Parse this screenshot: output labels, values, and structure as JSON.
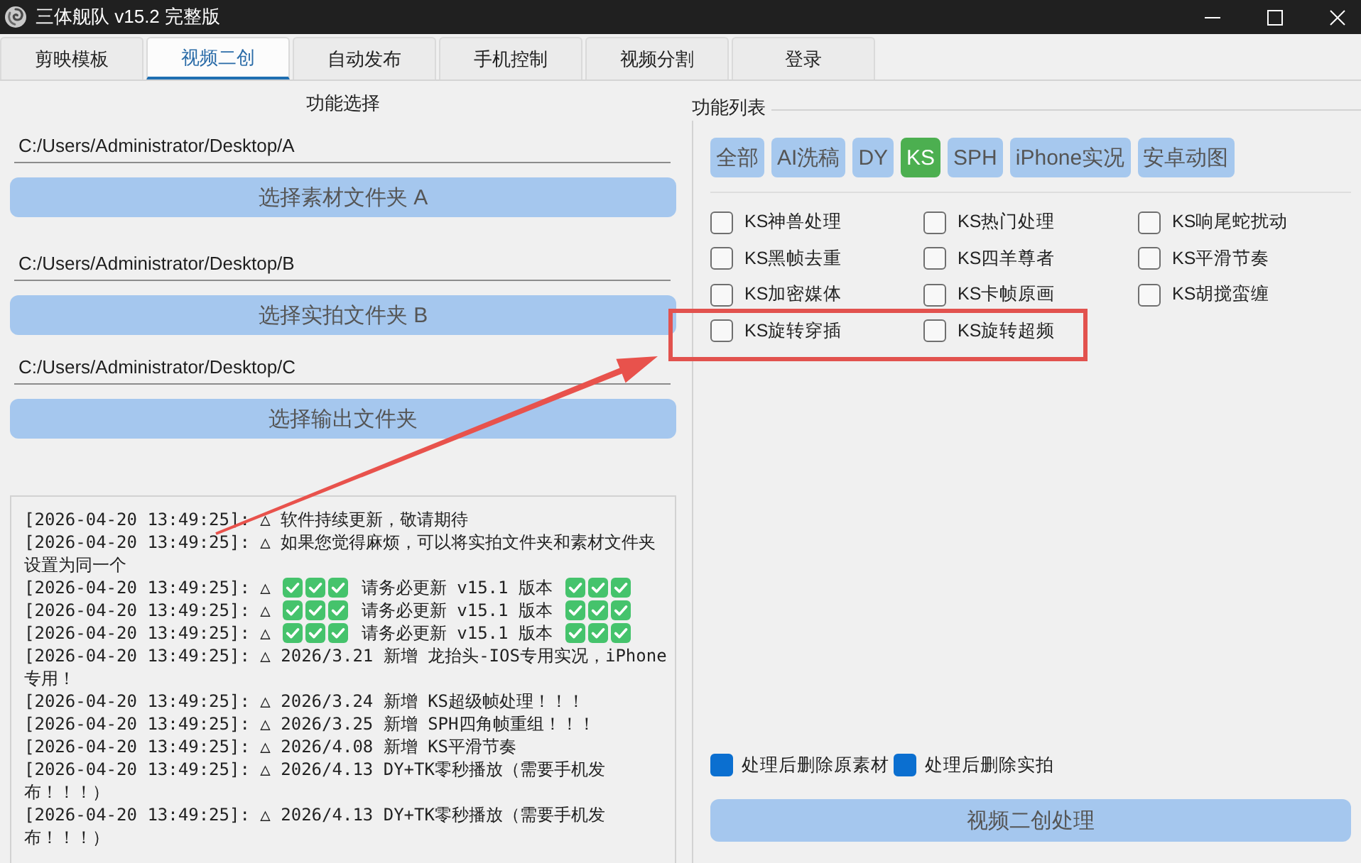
{
  "window": {
    "title": "三体舰队 v15.2 完整版"
  },
  "tabs": [
    {
      "label": "剪映模板",
      "selected": false
    },
    {
      "label": "视频二创",
      "selected": true
    },
    {
      "label": "自动发布",
      "selected": false
    },
    {
      "label": "手机控制",
      "selected": false
    },
    {
      "label": "视频分割",
      "selected": false
    },
    {
      "label": "登录",
      "selected": false
    }
  ],
  "folder_panel": {
    "title": "功能选择",
    "folders": [
      {
        "path": "C:/Users/Administrator/Desktop/A",
        "button": "选择素材文件夹 A"
      },
      {
        "path": "C:/Users/Administrator/Desktop/B",
        "button": "选择实拍文件夹 B"
      },
      {
        "path": "C:/Users/Administrator/Desktop/C",
        "button": "选择输出文件夹"
      }
    ]
  },
  "log": [
    {
      "parts": [
        {
          "kind": "text",
          "text": "[2026-04-20 13:49:25]: △ 软件持续更新，敬请期待"
        }
      ]
    },
    {
      "parts": [
        {
          "kind": "text",
          "text": "[2026-04-20 13:49:25]: △ 如果您觉得麻烦，可以将实拍文件夹和素材文件夹设置为同一个"
        }
      ]
    },
    {
      "parts": [
        {
          "kind": "text",
          "text": "[2026-04-20 13:49:25]: △"
        },
        {
          "kind": "check"
        },
        {
          "kind": "check"
        },
        {
          "kind": "check"
        },
        {
          "kind": "text",
          "text": "请务必更新 v15.1 版本"
        },
        {
          "kind": "check"
        },
        {
          "kind": "check"
        },
        {
          "kind": "check"
        }
      ]
    },
    {
      "parts": [
        {
          "kind": "text",
          "text": "[2026-04-20 13:49:25]: △"
        },
        {
          "kind": "check"
        },
        {
          "kind": "check"
        },
        {
          "kind": "check"
        },
        {
          "kind": "text",
          "text": "请务必更新 v15.1 版本"
        },
        {
          "kind": "check"
        },
        {
          "kind": "check"
        },
        {
          "kind": "check"
        }
      ]
    },
    {
      "parts": [
        {
          "kind": "text",
          "text": "[2026-04-20 13:49:25]: △"
        },
        {
          "kind": "check"
        },
        {
          "kind": "check"
        },
        {
          "kind": "check"
        },
        {
          "kind": "text",
          "text": "请务必更新 v15.1 版本"
        },
        {
          "kind": "check"
        },
        {
          "kind": "check"
        },
        {
          "kind": "check"
        }
      ]
    },
    {
      "parts": [
        {
          "kind": "text",
          "text": "[2026-04-20 13:49:25]: △ 2026/3.21 新增 龙抬头-IOS专用实况，iPhone专用！"
        }
      ]
    },
    {
      "parts": [
        {
          "kind": "text",
          "text": "[2026-04-20 13:49:25]: △ 2026/3.24 新增 KS超级帧处理！！！"
        }
      ]
    },
    {
      "parts": [
        {
          "kind": "text",
          "text": "[2026-04-20 13:49:25]: △ 2026/3.25 新增 SPH四角帧重组！！！"
        }
      ]
    },
    {
      "parts": [
        {
          "kind": "text",
          "text": "[2026-04-20 13:49:25]: △ 2026/4.08 新增 KS平滑节奏"
        }
      ]
    },
    {
      "parts": [
        {
          "kind": "text",
          "text": "[2026-04-20 13:49:25]: △ 2026/4.13 DY+TK零秒播放（需要手机发布！！！）"
        }
      ]
    },
    {
      "parts": [
        {
          "kind": "text",
          "text": "[2026-04-20 13:49:25]: △ 2026/4.13 DY+TK零秒播放（需要手机发布！！！）"
        }
      ]
    }
  ],
  "feature_list": {
    "title": "功能列表",
    "filters": [
      {
        "label": "全部",
        "selected": false
      },
      {
        "label": "AI洗稿",
        "selected": false
      },
      {
        "label": "DY",
        "selected": false
      },
      {
        "label": "KS",
        "selected": true
      },
      {
        "label": "SPH",
        "selected": false
      },
      {
        "label": "iPhone实况",
        "selected": false
      },
      {
        "label": "安卓动图",
        "selected": false
      }
    ],
    "features": [
      {
        "label": "KS神兽处理",
        "checked": false
      },
      {
        "label": "KS热门处理",
        "checked": false
      },
      {
        "label": "KS响尾蛇扰动",
        "checked": false
      },
      {
        "label": "KS黑帧去重",
        "checked": false
      },
      {
        "label": "KS四羊尊者",
        "checked": false
      },
      {
        "label": "KS平滑节奏",
        "checked": false
      },
      {
        "label": "KS加密媒体",
        "checked": false
      },
      {
        "label": "KS卡帧原画",
        "checked": false
      },
      {
        "label": "KS胡搅蛮缠",
        "checked": false
      },
      {
        "label": "KS旋转穿插",
        "checked": false
      },
      {
        "label": "KS旋转超频",
        "checked": false
      }
    ]
  },
  "options": [
    {
      "label": "处理后删除原素材",
      "checked": true
    },
    {
      "label": "处理后删除实拍",
      "checked": true
    }
  ],
  "process_button": {
    "label": "视频二创处理"
  }
}
